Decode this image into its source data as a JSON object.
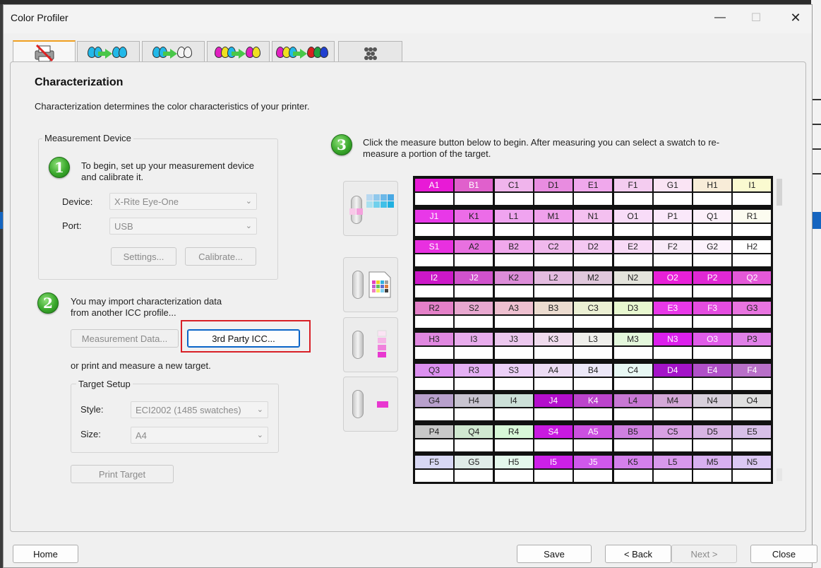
{
  "window": {
    "title": "Color Profiler",
    "minimize": "—",
    "maximize": "☐",
    "close": "✕"
  },
  "tabs": [
    {
      "name": "printer-setup",
      "active": true
    },
    {
      "name": "cyan-to-cyan",
      "active": false
    },
    {
      "name": "cyan-to-outline",
      "active": false
    },
    {
      "name": "cmy-to-cmy",
      "active": false
    },
    {
      "name": "cmy-to-rgb",
      "active": false
    },
    {
      "name": "pattern",
      "active": false
    }
  ],
  "page": {
    "title": "Characterization",
    "description": "Characterization determines the color characteristics of your printer."
  },
  "measurement": {
    "group_label": "Measurement Device",
    "step_number": "1",
    "step_text": "To begin, set up your measurement device and calibrate it.",
    "device_label": "Device:",
    "device_value": "X-Rite Eye-One",
    "port_label": "Port:",
    "port_value": "USB",
    "settings_button": "Settings...",
    "calibrate_button": "Calibrate..."
  },
  "import": {
    "step_number": "2",
    "step_text": "You may import characterization data from another ICC profile...",
    "measurement_data_button": "Measurement Data...",
    "third_party_button": "3rd Party ICC...",
    "or_text": "or print and measure a new target."
  },
  "target_setup": {
    "group_label": "Target Setup",
    "style_label": "Style:",
    "style_value": "ECI2002 (1485 swatches)",
    "size_label": "Size:",
    "size_value": "A4",
    "print_button": "Print Target"
  },
  "measure": {
    "step_number": "3",
    "step_text": "Click the measure button below to begin. After measuring you can select a swatch to re-measure a portion of the target."
  },
  "swatches": [
    [
      [
        "A1",
        "#e81ad6"
      ],
      [
        "B1",
        "#e060cc"
      ],
      [
        "C1",
        "#f0b4ec"
      ],
      [
        "D1",
        "#e88ce0"
      ],
      [
        "E1",
        "#f0a8ec"
      ],
      [
        "F1",
        "#f4ccf0"
      ],
      [
        "G1",
        "#fae4f4"
      ],
      [
        "H1",
        "#f8ecd8"
      ],
      [
        "I1",
        "#fafad0"
      ]
    ],
    [
      [
        "J1",
        "#e838e8"
      ],
      [
        "K1",
        "#ec6ce8"
      ],
      [
        "L1",
        "#f0a4f0"
      ],
      [
        "M1",
        "#f0a0ec"
      ],
      [
        "N1",
        "#f4c0f0"
      ],
      [
        "O1",
        "#f8dcf8"
      ],
      [
        "P1",
        "#fae8fa"
      ],
      [
        "Q1",
        "#fcf0fa"
      ],
      [
        "R1",
        "#fcfcf0"
      ]
    ],
    [
      [
        "S1",
        "#e830e0"
      ],
      [
        "A2",
        "#e870e0"
      ],
      [
        "B2",
        "#f0a8ec"
      ],
      [
        "C2",
        "#f0b8ec"
      ],
      [
        "D2",
        "#f4c8f2"
      ],
      [
        "E2",
        "#f8daf6"
      ],
      [
        "F2",
        "#f8eaf8"
      ],
      [
        "G2",
        "#fcf2fc"
      ],
      [
        "H2",
        "#ffffff"
      ]
    ],
    [
      [
        "I2",
        "#cc18c8"
      ],
      [
        "J2",
        "#d052cc"
      ],
      [
        "K2",
        "#dc8cd8"
      ],
      [
        "L2",
        "#e4bce0"
      ],
      [
        "M2",
        "#e0c8dc"
      ],
      [
        "N2",
        "#e4e4dc"
      ],
      [
        "O2",
        "#e820d8"
      ],
      [
        "P2",
        "#e028d4"
      ],
      [
        "Q2",
        "#e458d8"
      ]
    ],
    [
      [
        "R2",
        "#e480c8"
      ],
      [
        "S2",
        "#e8a8d0"
      ],
      [
        "A3",
        "#eec0d0"
      ],
      [
        "B3",
        "#ecdcd0"
      ],
      [
        "C3",
        "#ecf0d4"
      ],
      [
        "D3",
        "#e8f8d0"
      ],
      [
        "E3",
        "#e838e8"
      ],
      [
        "F3",
        "#e44ce0"
      ],
      [
        "G3",
        "#e874e0"
      ]
    ],
    [
      [
        "H3",
        "#e088e0"
      ],
      [
        "I3",
        "#e8acec"
      ],
      [
        "J3",
        "#ecc8ee"
      ],
      [
        "K3",
        "#f0dcee"
      ],
      [
        "L3",
        "#f0f0ec"
      ],
      [
        "M3",
        "#e4f8dc"
      ],
      [
        "N3",
        "#dc20ec"
      ],
      [
        "O3",
        "#e05ce8"
      ],
      [
        "P3",
        "#e080e8"
      ]
    ],
    [
      [
        "Q3",
        "#dc90f0"
      ],
      [
        "R3",
        "#e4b0f4"
      ],
      [
        "S3",
        "#ecd0f8"
      ],
      [
        "A4",
        "#ecdcf4"
      ],
      [
        "B4",
        "#ece8f8"
      ],
      [
        "C4",
        "#e8f8f4"
      ],
      [
        "D4",
        "#a414c8"
      ],
      [
        "E4",
        "#b050c8"
      ],
      [
        "F4",
        "#b870c8"
      ]
    ],
    [
      [
        "G4",
        "#b8a0cc"
      ],
      [
        "H4",
        "#c8c4d0"
      ],
      [
        "I4",
        "#cce0d8"
      ],
      [
        "J4",
        "#b40ecc"
      ],
      [
        "K4",
        "#bc44cc"
      ],
      [
        "L4",
        "#c878d4"
      ],
      [
        "M4",
        "#d4a8d8"
      ],
      [
        "N4",
        "#d8d0dc"
      ],
      [
        "O4",
        "#e0e0e0"
      ]
    ],
    [
      [
        "P4",
        "#c8c8c8"
      ],
      [
        "Q4",
        "#d0e8d0"
      ],
      [
        "R4",
        "#d8f8d8"
      ],
      [
        "S4",
        "#c81ae0"
      ],
      [
        "A5",
        "#cc50e0"
      ],
      [
        "B5",
        "#d080e0"
      ],
      [
        "C5",
        "#d8a0e4"
      ],
      [
        "D5",
        "#d8b4e4"
      ],
      [
        "E5",
        "#d8c0e8"
      ]
    ],
    [
      [
        "F5",
        "#d8d8f4"
      ],
      [
        "G5",
        "#e0ece8"
      ],
      [
        "H5",
        "#e4f8ec"
      ],
      [
        "I5",
        "#cc20e8"
      ],
      [
        "J5",
        "#d058ec"
      ],
      [
        "K5",
        "#d480ec"
      ],
      [
        "L5",
        "#d898ec"
      ],
      [
        "M5",
        "#d8b0f0"
      ],
      [
        "N5",
        "#dcc8f4"
      ]
    ]
  ],
  "footer": {
    "home_button": "Home",
    "save_button": "Save",
    "back_button": "< Back",
    "next_button": "Next >",
    "close_button": "Close"
  }
}
